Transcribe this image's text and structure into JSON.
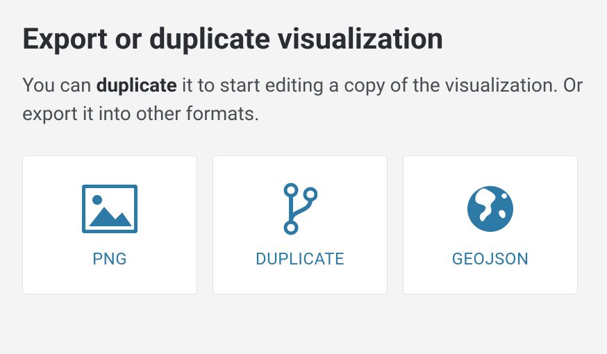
{
  "title": "Export or duplicate visualization",
  "description": {
    "pre": "You can ",
    "bold": "duplicate",
    "post": " it to start editing a copy of the visualization. Or export it into other formats."
  },
  "cards": {
    "png": {
      "label": "PNG"
    },
    "duplicate": {
      "label": "DUPLICATE"
    },
    "geojson": {
      "label": "GEOJSON"
    }
  }
}
